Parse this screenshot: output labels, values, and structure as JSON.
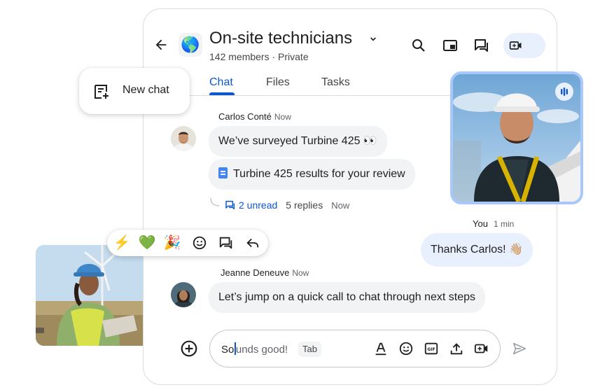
{
  "header": {
    "title": "On-site technicians",
    "avatar_emoji": "🌎",
    "subtitle": "142 members · Private"
  },
  "tabs": [
    {
      "label": "Chat",
      "active": true
    },
    {
      "label": "Files",
      "active": false
    },
    {
      "label": "Tasks",
      "active": false
    }
  ],
  "new_chat": {
    "label": "New chat"
  },
  "messages": {
    "carlos": {
      "name": "Carlos Conté",
      "time": "Now",
      "text": "We’ve surveyed Turbine 425 👀",
      "attachment": "Turbine 425 results  for your review",
      "thread": {
        "unread": "2 unread",
        "replies": "5 replies",
        "time": "Now"
      }
    },
    "you": {
      "name": "You",
      "time": "1 min",
      "text": "Thanks Carlos! 👋🏼"
    },
    "jeanne": {
      "name": "Jeanne Deneuve",
      "time": "Now",
      "text": "Let’s jump on a quick call to chat through next steps"
    }
  },
  "reactions": [
    "⚡",
    "💚",
    "🎉"
  ],
  "compose": {
    "typed": "So",
    "suggestion": "unds good!",
    "tab_hint": "Tab"
  },
  "colors": {
    "accent": "#0b57d0",
    "bubble": "#f1f3f4",
    "bubble_self": "#e8f0fe",
    "video_border": "#a8c7fa"
  },
  "icons": {
    "back": "arrow-left-icon",
    "search": "search-icon",
    "pip": "picture-in-picture-icon",
    "threads": "threads-icon",
    "meet": "video-meet-icon",
    "new_chat": "new-chat-icon",
    "speaking": "speaking-indicator-icon",
    "add": "add-circle-icon",
    "format": "text-format-icon",
    "emoji": "emoji-icon",
    "gif": "gif-icon",
    "upload": "upload-icon",
    "video_call": "video-call-icon",
    "send": "send-icon",
    "reply": "reply-icon"
  }
}
